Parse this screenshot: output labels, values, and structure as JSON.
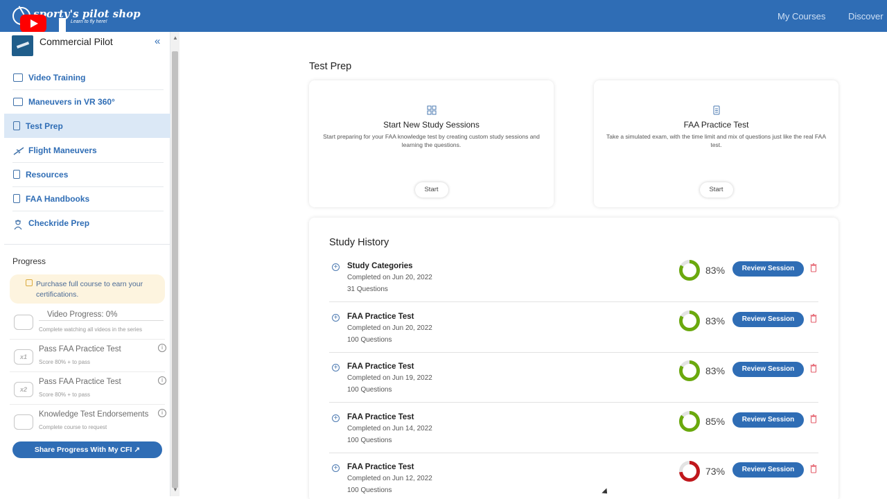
{
  "header": {
    "logo_text": "sporty's pilot shop",
    "logo_tagline": "Learn to fly here!",
    "nav": [
      "My Courses",
      "Discover"
    ]
  },
  "sidebar": {
    "course_title": "Commercial Pilot",
    "items": [
      {
        "label": "Video Training",
        "icon": "video-icon"
      },
      {
        "label": "Maneuvers in VR 360°",
        "icon": "vr-icon"
      },
      {
        "label": "Test Prep",
        "icon": "document-icon",
        "active": true
      },
      {
        "label": "Flight Maneuvers",
        "icon": "airplane-icon"
      },
      {
        "label": "Resources",
        "icon": "file-icon"
      },
      {
        "label": "FAA Handbooks",
        "icon": "book-icon"
      },
      {
        "label": "Checkride Prep",
        "icon": "pilot-icon"
      }
    ],
    "progress": {
      "title": "Progress",
      "purchase_note": "Purchase full course to earn your certifications.",
      "rows": [
        {
          "name": "Video Progress: 0%",
          "sub": "Complete watching all videos in the series",
          "badge": ""
        },
        {
          "name": "Pass FAA Practice Test",
          "sub": "Score 80% + to pass",
          "badge": "x1"
        },
        {
          "name": "Pass FAA Practice Test",
          "sub": "Score 80% + to pass",
          "badge": "x2"
        },
        {
          "name": "Knowledge Test Endorsements",
          "sub": "Complete course to request",
          "badge": ""
        }
      ],
      "share_label": "Share Progress With My CFI"
    }
  },
  "main": {
    "title": "Test Prep",
    "cards": [
      {
        "title": "Start New Study Sessions",
        "description": "Start preparing for your FAA knowledge test by creating custom study sessions and learning the questions.",
        "button": "Start"
      },
      {
        "title": "FAA Practice Test",
        "description": "Take a simulated exam, with the time limit and mix of questions just like the real FAA test.",
        "button": "Start"
      }
    ],
    "history": {
      "title": "Study History",
      "review_label": "Review Session",
      "rows": [
        {
          "title": "Study Categories",
          "date": "Completed on Jun 20, 2022",
          "questions": "31 Questions",
          "percent": 83
        },
        {
          "title": "FAA Practice Test",
          "date": "Completed on Jun 20, 2022",
          "questions": "100 Questions",
          "percent": 83
        },
        {
          "title": "FAA Practice Test",
          "date": "Completed on Jun 19, 2022",
          "questions": "100 Questions",
          "percent": 83
        },
        {
          "title": "FAA Practice Test",
          "date": "Completed on Jun 14, 2022",
          "questions": "100 Questions",
          "percent": 85
        },
        {
          "title": "FAA Practice Test",
          "date": "Completed on Jun 12, 2022",
          "questions": "100 Questions",
          "percent": 73
        }
      ]
    }
  },
  "colors": {
    "brand_blue": "#2f6db5",
    "pass_green": "#6aa90d",
    "fail_red": "#c0171c",
    "donut_track": "#e3e3e3",
    "trash_red": "#e35d6a"
  }
}
